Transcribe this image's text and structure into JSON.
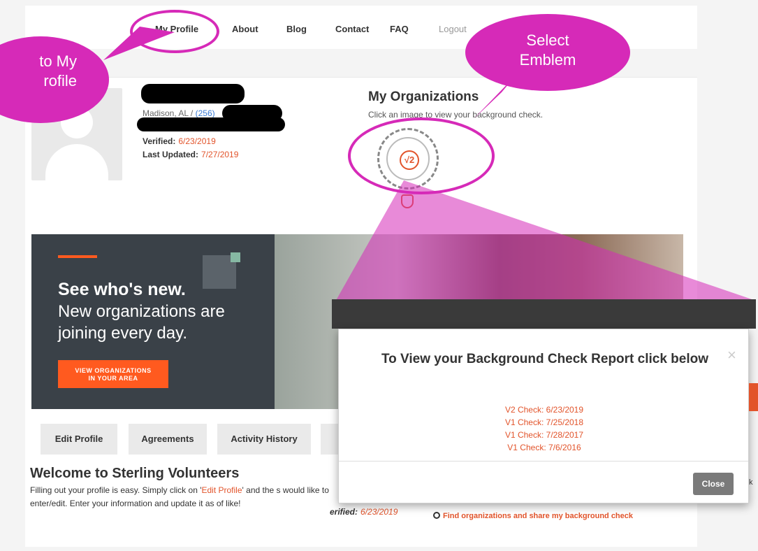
{
  "nav": {
    "items": [
      "My Profile",
      "About",
      "Blog",
      "Contact",
      "FAQ",
      "Logout"
    ]
  },
  "profile": {
    "location": "Madison, AL / ",
    "phone": "(256)",
    "verified_label": "Verified:",
    "verified_value": "6/23/2019",
    "updated_label": "Last Updated:",
    "updated_value": "7/27/2019"
  },
  "organizations": {
    "title": "My Organizations",
    "subtitle": "Click an image to view your background check."
  },
  "emblem": {
    "text": "√2"
  },
  "banner": {
    "headline": "See who's new.",
    "text": "New organizations are joining every day.",
    "button_line1": "VIEW ORGANIZATIONS",
    "button_line2": "IN YOUR AREA"
  },
  "tabs": [
    "Edit Profile",
    "Agreements",
    "Activity History"
  ],
  "welcome": {
    "title": "Welcome to Sterling Volunteers",
    "text_before": "Filling out your profile is easy. Simply click on '",
    "link": "Edit Profile",
    "text_after": "' and the s would like to enter/edit. Enter your information and update it as of like!"
  },
  "behind": {
    "verified_label": "erified:",
    "verified_value": "6/23/2019",
    "find_link": "Find organizations and share my background check"
  },
  "modal": {
    "title": "To View your Background Check Report click below",
    "close_x": "×",
    "checks": [
      "V2  Check:  6/23/2019",
      "V1  Check:  7/25/2018",
      "V1  Check:  7/28/2017",
      "V1  Check:  7/6/2016"
    ],
    "close_button": "Close",
    "side_letter": "k"
  },
  "annotations": {
    "bubble_profile": "to My\nrofile",
    "bubble_emblem": "Select\nEmblem",
    "color": "#d62ab8"
  }
}
